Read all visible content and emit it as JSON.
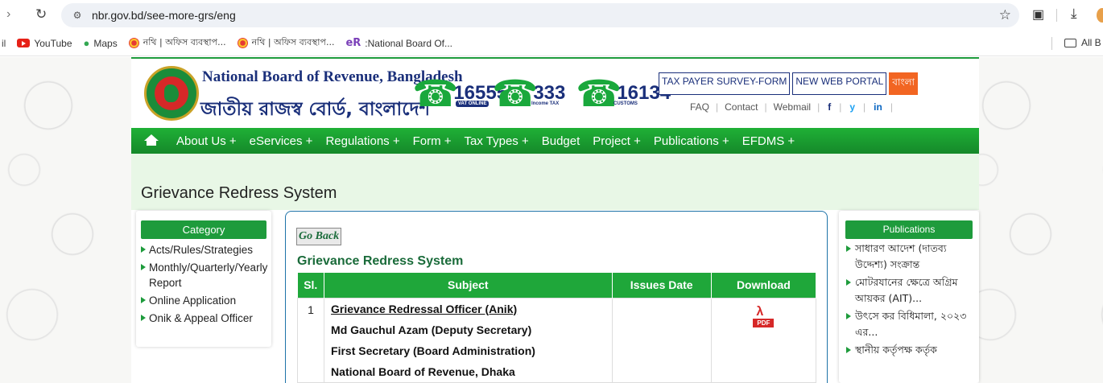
{
  "browser": {
    "url": "nbr.gov.bd/see-more-grs/eng",
    "bookmarks": [
      {
        "label": "YouTube",
        "icon": "youtube-icon"
      },
      {
        "label": "Maps",
        "icon": "maps-icon"
      },
      {
        "label": "নথি | অফিস ব্যবস্থাপ...",
        "icon": "nothi-icon"
      },
      {
        "label": "নথি | অফিস ব্যবস্থাপ...",
        "icon": "nothi-icon"
      },
      {
        "label": ":National Board Of...",
        "icon": "er-icon"
      }
    ],
    "bookmark_left_fragment": "il",
    "all_bookmarks": "All B"
  },
  "header": {
    "name_en": "National Board of Revenue, Bangladesh",
    "name_bn": "জাতীয় রাজস্ব বোর্ড, বাংলাদেশ",
    "hotlines": [
      {
        "number": "16555",
        "sub": "VAT ONLINE"
      },
      {
        "number": "333",
        "sub": "Income TAX"
      },
      {
        "number": "16134",
        "sub": "CUSTOMS"
      }
    ],
    "buttons": [
      "TAX PAYER SURVEY-FORM",
      "NEW WEB PORTAL",
      "বাংলা"
    ],
    "quick_links": [
      "FAQ",
      "Contact",
      "Webmail"
    ],
    "social": [
      "f",
      "y",
      "in"
    ]
  },
  "nav": [
    "About Us +",
    "eServices +",
    "Regulations +",
    "Form +",
    "Tax Types +",
    "Budget",
    "Project +",
    "Publications +",
    "EFDMS +"
  ],
  "page_title": "Grievance Redress System",
  "sidebar": {
    "heading": "Category",
    "items": [
      "Acts/Rules/Strategies",
      "Monthly/Quarterly/Yearly Report",
      "Online Application",
      "Onik & Appeal Officer"
    ]
  },
  "center": {
    "go_back": "Go Back",
    "title": "Grievance Redress System",
    "columns": [
      "Sl.",
      "Subject",
      "Issues Date",
      "Download"
    ],
    "row": {
      "sl": "1",
      "lines": [
        "Grievance Redressal Officer (Anik)",
        "Md Gauchul Azam (Deputy Secretary)",
        "First Secretary (Board Administration)",
        "National Board of Revenue, Dhaka"
      ],
      "date": "",
      "pdf_label": "PDF"
    }
  },
  "publications": {
    "heading": "Publications",
    "items": [
      "সাধারণ আদেশ (দাতব্য উদ্দেশ্য) সংক্রান্ত",
      "মোটরযানের ক্ষেত্রে অগ্রিম আয়কর (AIT)...",
      "উৎসে কর বিধিমালা, ২০২৩ এর...",
      "স্থানীয় কর্তৃপক্ষ কর্তৃক"
    ]
  }
}
